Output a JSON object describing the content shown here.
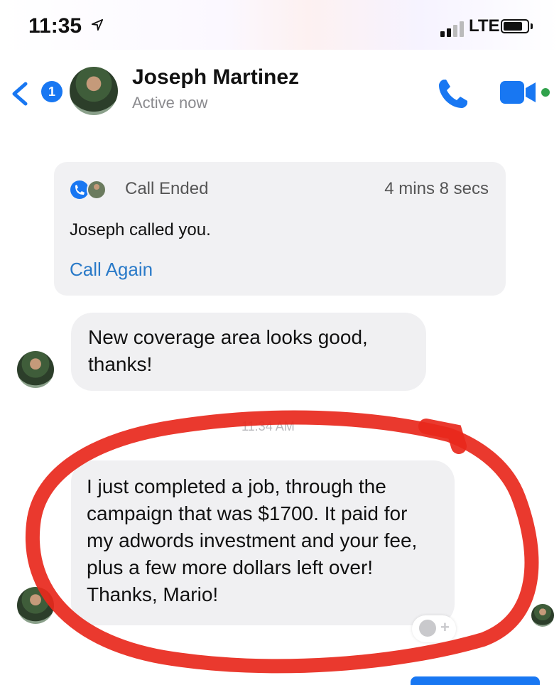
{
  "status_bar": {
    "time": "11:35",
    "network": "LTE"
  },
  "header": {
    "contact_name": "Joseph Martinez",
    "contact_status": "Active now",
    "unread_count": "1"
  },
  "call_card": {
    "title": "Call Ended",
    "duration": "4 mins 8 secs",
    "description": "Joseph called you.",
    "action_label": "Call Again"
  },
  "messages": [
    {
      "text": "New coverage area looks good, thanks!"
    },
    {
      "timestamp": "11:34 AM",
      "text": "I just completed a job, through the campaign that was $1700. It paid for my adwords investment and your fee, plus a few more dollars left over! Thanks, Mario!"
    }
  ],
  "colors": {
    "accent": "#1877f2",
    "annotation": "#e8281c",
    "bubble": "#f0f0f2",
    "online": "#31a24c"
  },
  "icons": [
    "location-arrow-icon",
    "signal-icon",
    "battery-icon",
    "back-chevron-icon",
    "phone-icon",
    "video-camera-icon",
    "add-reaction-icon"
  ]
}
